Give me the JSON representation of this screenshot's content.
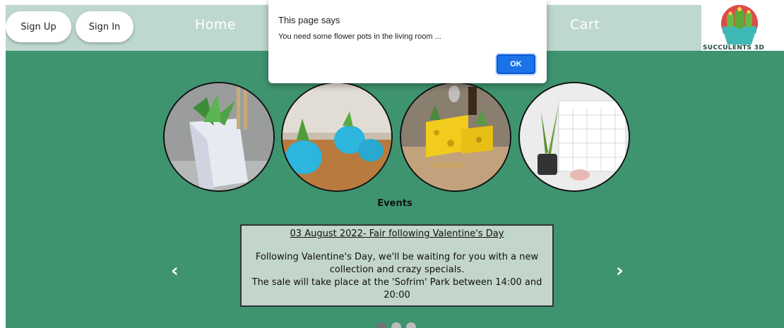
{
  "header": {
    "signup_label": "Sign Up",
    "signin_label": "Sign In",
    "nav": {
      "home": "Home",
      "cart": "Cart"
    },
    "logo_text": "SUCCULENTS 3D"
  },
  "gallery": [
    {
      "icon": "planter-takeout-box-image"
    },
    {
      "icon": "planter-blue-creature-image"
    },
    {
      "icon": "planter-cheese-block-image"
    },
    {
      "icon": "planter-calendar-desk-image"
    }
  ],
  "events": {
    "title": "Events",
    "card": {
      "title": "03 August 2022- Fair following Valentine's Day",
      "line1": "Following Valentine's Day, we'll be waiting for you with a new collection and crazy specials.",
      "line2": "The sale will take place at the 'Sofrim' Park between 14:00 and 20:00"
    },
    "prev_label": "‹",
    "next_label": "›",
    "active_slide": 1,
    "slide_count": 3
  },
  "dialog": {
    "title": "This page says",
    "message": "You need some flower pots in the living room ...",
    "ok_label": "OK"
  },
  "colors": {
    "header_bg": "#bfd8cd",
    "main_bg": "#3f9470",
    "card_bg": "#c3d6cc",
    "ok_button": "#1a73e8"
  }
}
